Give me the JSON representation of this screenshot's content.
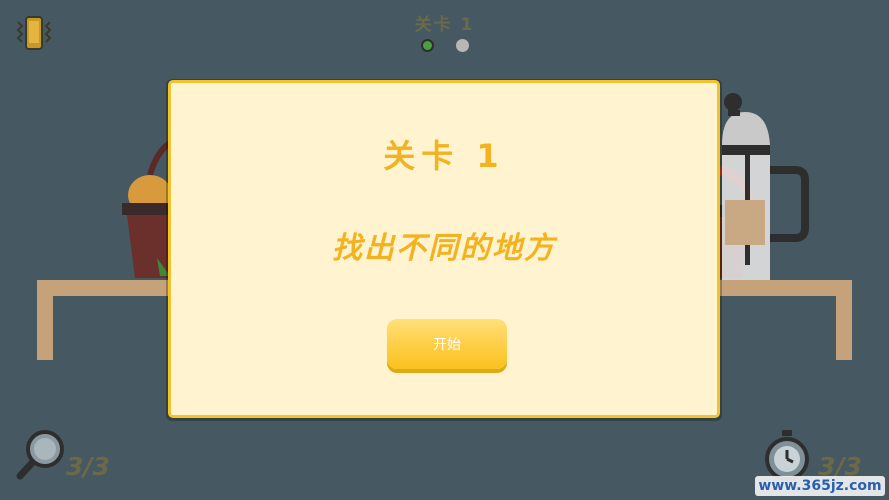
{
  "header": {
    "level_title": "关卡 1",
    "vibrate_icon": "vibrate-phone-icon",
    "progress": {
      "current": 1,
      "total": 2
    }
  },
  "modal": {
    "title": "关卡 1",
    "subtitle": "找出不同的地方",
    "start_label": "开始"
  },
  "footer": {
    "hints_counter": "3/3",
    "time_counter": "3/3",
    "hint_icon": "magnifier-icon",
    "time_icon": "stopwatch-icon",
    "watermark": "www.365jz.com"
  },
  "colors": {
    "background": "#465861",
    "modal_fill": "#fff4cf",
    "modal_border": "#f2c32c",
    "accent_text": "#f3b21f",
    "active_dot": "#4ca23a"
  }
}
